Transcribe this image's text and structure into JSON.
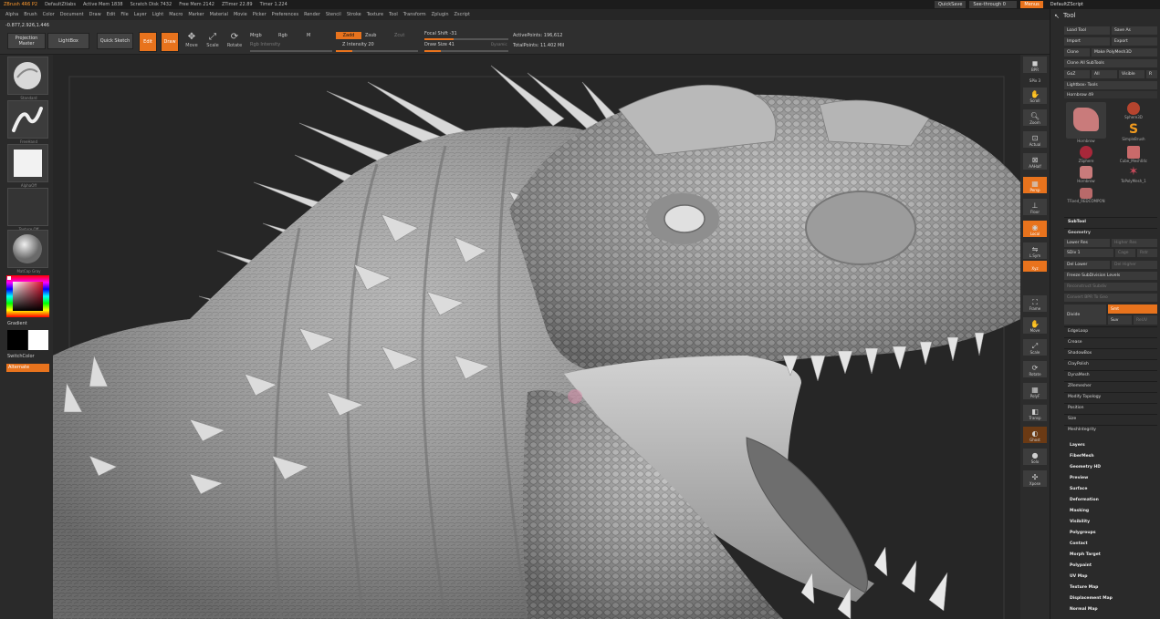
{
  "app": {
    "title": "ZBrush 4R6 P2",
    "document": "DefaultZtlabs",
    "stats": [
      "Active Mem 1838",
      "Scratch Disk 7432",
      "Free Mem 2142",
      "ZTimer 22.89",
      "Timer 1.224"
    ],
    "top_right": {
      "quicksave": "QuickSave",
      "seethrough": "See-through 0",
      "menus": "Menus",
      "script": "DefaultZScript"
    }
  },
  "menus": [
    "Alpha",
    "Brush",
    "Color",
    "Document",
    "Draw",
    "Edit",
    "File",
    "Layer",
    "Light",
    "Macro",
    "Marker",
    "Material",
    "Movie",
    "Picker",
    "Preferences",
    "Render",
    "Stencil",
    "Stroke",
    "Texture",
    "Tool",
    "Transform",
    "Zplugin",
    "Zscript"
  ],
  "toolbar": {
    "coords": "-0.877,2.926,1.446",
    "projection_master": "Projection Master",
    "lightbox": "LightBox",
    "quick_sketch": "Quick Sketch",
    "edit": "Edit",
    "draw": "Draw",
    "move": "Move",
    "scale": "Scale",
    "rotate": "Rotate",
    "mrgb": "Mrgb",
    "rgb": "Rgb",
    "m": "M",
    "rgb_intensity": "Rgb Intensity",
    "zadd": "Zadd",
    "zsub": "Zsub",
    "zcut": "Zcut",
    "z_intensity": "Z Intensity 20",
    "z_intensity_value": 0.2,
    "focal_shift": "Focal Shift -31",
    "focal_shift_value": 0.35,
    "draw_size": "Draw Size 41",
    "draw_size_value": 0.2,
    "dynamic": "Dynamic",
    "active_points": "ActivePoints: 196,612",
    "total_points": "TotalPoints: 11.402 Mil"
  },
  "left_shelf": {
    "thumbs": [
      "Standard",
      "FreeHand",
      "AlphaOff",
      "Texture Off",
      "MatCap Gray"
    ],
    "gradient": "Gradient",
    "switch_color": "SwitchColor",
    "alternate": "Alternate"
  },
  "right_strip": [
    {
      "icon": "bpr-icon",
      "label": "BPR"
    },
    {
      "icon": "spix-icon",
      "label": "SPix 3"
    },
    {
      "icon": "scroll-icon",
      "label": "Scroll"
    },
    {
      "icon": "zoom-icon",
      "label": "Zoom"
    },
    {
      "icon": "actual-icon",
      "label": "Actual"
    },
    {
      "icon": "aahalf-icon",
      "label": "AAHalf"
    },
    {
      "icon": "persp-icon",
      "label": "Persp"
    },
    {
      "icon": "floor-icon",
      "label": "Floor"
    },
    {
      "icon": "local-icon",
      "label": "Local"
    },
    {
      "icon": "lsym-icon",
      "label": "L.Sym"
    },
    {
      "icon": "xyz-icon",
      "label": "Xyz"
    },
    {
      "icon": "frame-icon",
      "label": "Frame"
    },
    {
      "icon": "move-icon",
      "label": "Move"
    },
    {
      "icon": "scale-icon",
      "label": "Scale"
    },
    {
      "icon": "rotate-icon",
      "label": "Rotate"
    },
    {
      "icon": "polyf-icon",
      "label": "PolyF"
    },
    {
      "icon": "transp-icon",
      "label": "Transp"
    },
    {
      "icon": "ghost-icon",
      "label": "Ghost"
    },
    {
      "icon": "solo-icon",
      "label": "Solo"
    },
    {
      "icon": "xpose-icon",
      "label": "Xpose"
    }
  ],
  "tool_panel": {
    "title": "Tool",
    "load_tool": "Load Tool",
    "save_as": "Save As",
    "import": "Import",
    "export": "Export",
    "clone": "Clone",
    "make_polymesh": "Make PolyMesh3D",
    "clone_all": "Clone All SubTools",
    "goz": "GoZ",
    "all": "All",
    "visible": "Visible",
    "r": "R",
    "lightbox_tools": "Lightbox› Tools",
    "item_name": "Hornbrow 49",
    "tools": [
      "Hornbrow",
      "Sphere3D",
      "ZSphere",
      "SimpleBrush",
      "Hornbrow",
      "Cube_Mesh04c",
      "TFixed_REDCOMPON",
      "ToPolyMesh_1"
    ],
    "subtool": "SubTool",
    "geometry": "Geometry",
    "lower_res": "Lower Res",
    "higher_res": "Higher Res",
    "sdiv": "SDiv 1",
    "cage": "Cage",
    "rstr": "Rstr",
    "del_lower": "Del Lower",
    "del_higher": "Del Higher",
    "freeze_subdiv": "Freeze SubDivision Levels",
    "reconstruct": "Reconstruct Subdiv",
    "convert_bpr": "Convert BPR To Geo",
    "divide": "Divide",
    "smt": "Smt",
    "suv": "Suv",
    "reuv": "ReUV",
    "geometry_items": [
      "EdgeLoop",
      "Crease",
      "ShadowBox",
      "ClayPolish",
      "DynaMesh",
      "ZRemesher",
      "Modify Topology",
      "Position",
      "Size",
      "MeshIntegrity"
    ],
    "sections": [
      "Layers",
      "FiberMesh",
      "Geometry HD",
      "Preview",
      "Surface",
      "Deformation",
      "Masking",
      "Visibility",
      "Polygroups",
      "Contact",
      "Morph Target",
      "Polypaint",
      "UV Map",
      "Texture Map",
      "Displacement Map",
      "Normal Map"
    ]
  },
  "colors": {
    "accent": "#e8731d",
    "panel": "#2a2a2a",
    "canvas": "#262626",
    "sculpt": "#a9a9a9"
  }
}
